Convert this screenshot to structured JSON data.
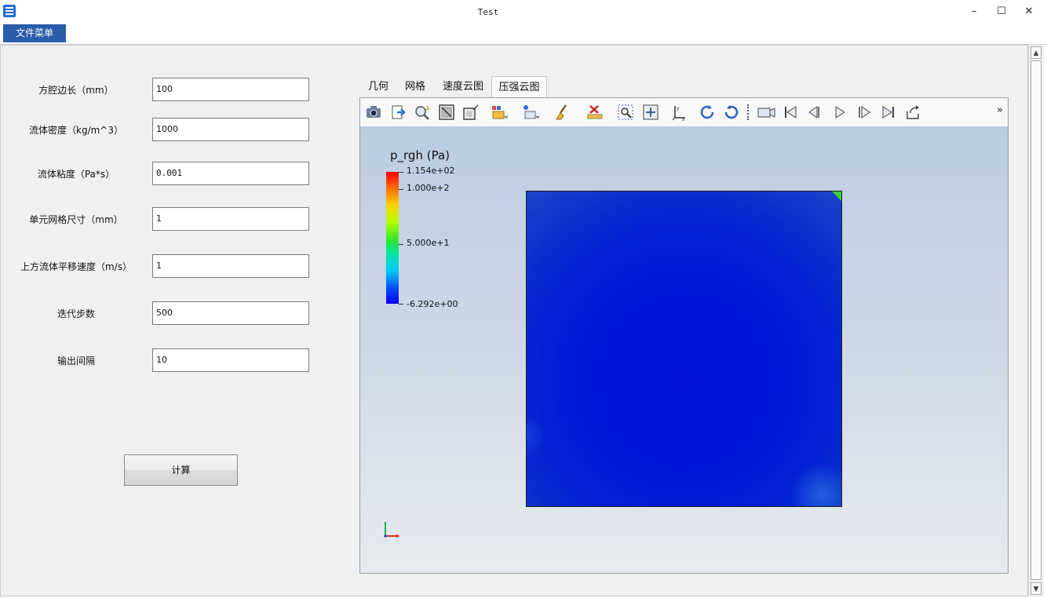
{
  "window": {
    "title": "Test",
    "minimize": "–",
    "maximize": "☐",
    "close": "✕"
  },
  "menu": {
    "file": "文件菜单"
  },
  "form": {
    "fields": [
      {
        "label": "方腔边长（mm）",
        "value": "100"
      },
      {
        "label": "流体密度（kg/m^3）",
        "value": "1000"
      },
      {
        "label": "流体粘度（Pa*s）",
        "value": "0.001"
      },
      {
        "label": "单元网格尺寸（mm）",
        "value": "1"
      },
      {
        "label": "上方流体平移速度（m/s）",
        "value": "1"
      },
      {
        "label": "迭代步数",
        "value": "500"
      },
      {
        "label": "输出间隔",
        "value": "10"
      }
    ],
    "compute_button": "计算"
  },
  "tabs": [
    "几何",
    "网格",
    "速度云图",
    "压强云图"
  ],
  "active_tab": "压强云图",
  "toolbar": {
    "icons": [
      "camera-icon",
      "export-icon",
      "zoom-probe-icon",
      "reset-view-icon",
      "view-box-icon",
      "select-cells-icon",
      "select-points-icon",
      "clear-brush-icon",
      "delete-ruler-icon",
      "zoom-region-icon",
      "center-icon",
      "axes-icon",
      "rotate-cw-icon",
      "rotate-ccw-icon",
      "video-camera-icon",
      "first-frame-icon",
      "prev-frame-icon",
      "play-icon",
      "next-frame-icon",
      "last-frame-icon",
      "loop-icon"
    ],
    "more": "»"
  },
  "legend": {
    "title": "p_rgh (Pa)",
    "ticks": [
      "1.154e+02",
      "1.000e+2",
      "5.000e+1",
      "-6.292e+00"
    ],
    "colors": [
      "#ff0000",
      "#ffd200",
      "#2ee62e",
      "#00c8ff",
      "#0000ff"
    ]
  },
  "plot": {
    "background": "#1018d6",
    "edge_color": "#36d23e"
  }
}
